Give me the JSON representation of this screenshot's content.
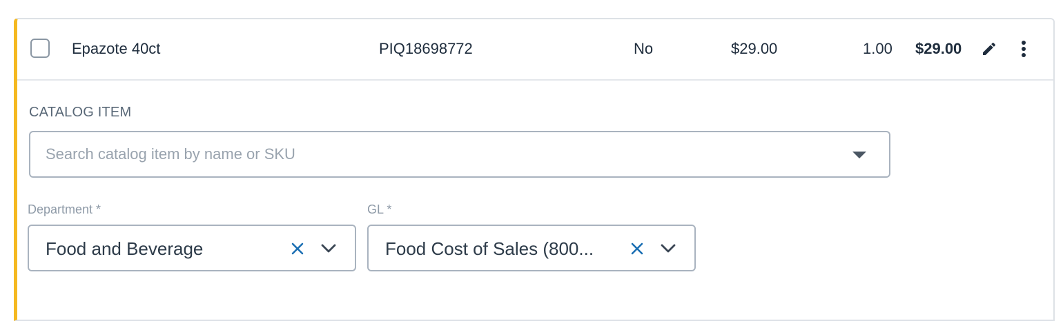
{
  "line_item": {
    "name": "Epazote 40ct",
    "sku": "PIQ18698772",
    "taxable": "No",
    "unit_price": "$29.00",
    "quantity": "1.00",
    "total": "$29.00"
  },
  "catalog": {
    "label": "CATALOG ITEM",
    "placeholder": "Search catalog item by name or SKU"
  },
  "department": {
    "label": "Department *",
    "value": "Food and Beverage"
  },
  "gl": {
    "label": "GL *",
    "value": "Food Cost of Sales (800..."
  },
  "colors": {
    "accent_border": "#f5b820",
    "clear_icon": "#1b6fb3"
  },
  "icons": {
    "edit": "pencil-icon",
    "menu": "kebab-menu-icon",
    "dropdown": "caret-down-icon",
    "clear": "close-icon",
    "expand": "chevron-down-icon"
  }
}
